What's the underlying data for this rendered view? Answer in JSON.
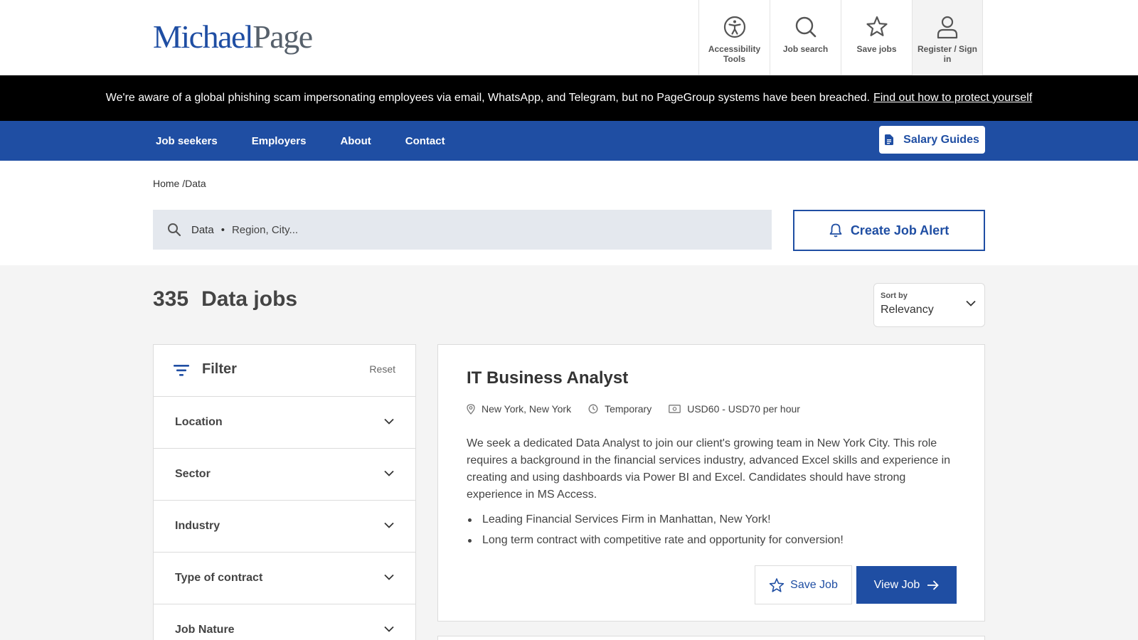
{
  "brand": {
    "logo_part1": "Michael",
    "logo_part2": "Page",
    "primary_color": "#1f4ea3"
  },
  "util_nav": [
    {
      "label": "Accessibility Tools",
      "icon": "accessibility-icon"
    },
    {
      "label": "Job search",
      "icon": "search-icon"
    },
    {
      "label": "Save jobs",
      "icon": "star-icon"
    },
    {
      "label": "Register / Sign in",
      "icon": "user-icon"
    }
  ],
  "banner": {
    "text": "We're aware of a global phishing scam impersonating employees via email, WhatsApp, and Telegram, but no PageGroup systems have been breached.",
    "link": "Find out how to protect yourself"
  },
  "main_nav": {
    "items": [
      "Job seekers",
      "Employers",
      "About",
      "Contact"
    ],
    "salary_guides": "Salary Guides"
  },
  "breadcrumb": "Home /Data",
  "search": {
    "keyword": "Data",
    "separator": "•",
    "location_placeholder": "Region, City..."
  },
  "create_alert": "Create Job Alert",
  "results": {
    "count": "335",
    "title": "Data jobs"
  },
  "sort": {
    "label": "Sort by",
    "value": "Relevancy"
  },
  "filter": {
    "title": "Filter",
    "reset": "Reset",
    "facets": [
      "Location",
      "Sector",
      "Industry",
      "Type of contract",
      "Job Nature"
    ]
  },
  "job": {
    "title": "IT Business Analyst",
    "location": "New York, New York",
    "contract": "Temporary",
    "salary": "USD60 - USD70 per hour",
    "description": "We seek a dedicated Data Analyst to join our client's growing team in New York City. This role requires a background in the financial services industry, advanced Excel skills and experience in creating and using dashboards via Power BI and Excel. Candidates should have strong experience in MS Access.",
    "bullets": [
      "Leading Financial Services Firm in Manhattan, New York!",
      "Long term contract with competitive rate and opportunity for conversion!"
    ],
    "save_label": "Save Job",
    "view_label": "View Job"
  }
}
